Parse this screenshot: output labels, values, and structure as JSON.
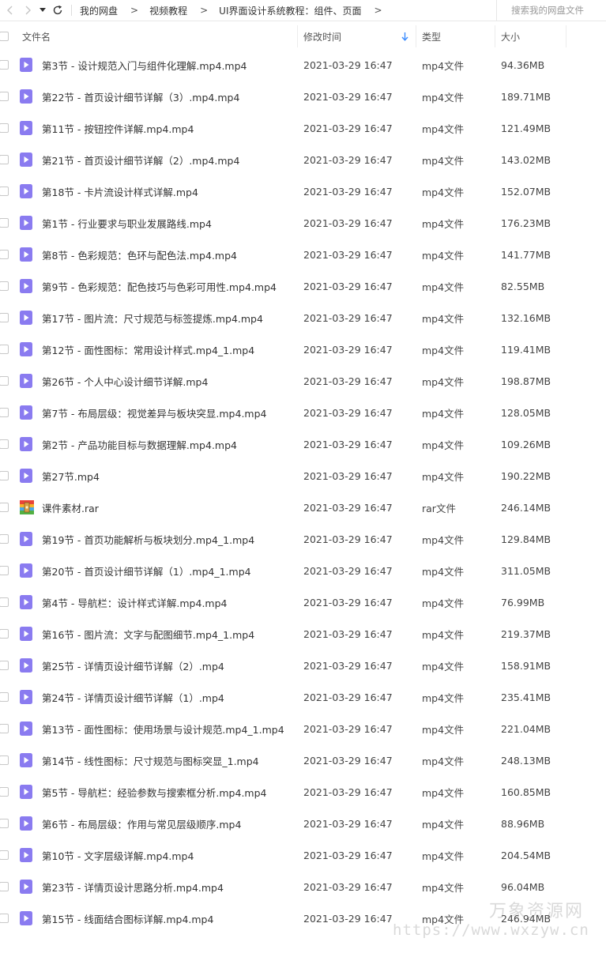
{
  "toolbar": {
    "breadcrumbs": [
      "我的网盘",
      "视频教程",
      "UI界面设计系统教程：组件、页面"
    ],
    "search_placeholder": "搜索我的网盘文件"
  },
  "columns": {
    "name": "文件名",
    "time": "修改时间",
    "type": "类型",
    "size": "大小",
    "sort_icon": "arrow-down-icon"
  },
  "colors": {
    "video_icon": "#8a7bf0",
    "sort_arrow": "#3b8cff"
  },
  "files": [
    {
      "name": "第3节 - 设计规范入门与组件化理解.mp4.mp4",
      "time": "2021-03-29 16:47",
      "type": "mp4文件",
      "size": "94.36MB",
      "icon": "video-file-icon"
    },
    {
      "name": "第22节 - 首页设计细节详解（3）.mp4.mp4",
      "time": "2021-03-29 16:47",
      "type": "mp4文件",
      "size": "189.71MB",
      "icon": "video-file-icon"
    },
    {
      "name": "第11节 - 按钮控件详解.mp4.mp4",
      "time": "2021-03-29 16:47",
      "type": "mp4文件",
      "size": "121.49MB",
      "icon": "video-file-icon"
    },
    {
      "name": "第21节 - 首页设计细节详解（2）.mp4.mp4",
      "time": "2021-03-29 16:47",
      "type": "mp4文件",
      "size": "143.02MB",
      "icon": "video-file-icon"
    },
    {
      "name": "第18节 - 卡片流设计样式详解.mp4",
      "time": "2021-03-29 16:47",
      "type": "mp4文件",
      "size": "152.07MB",
      "icon": "video-file-icon"
    },
    {
      "name": "第1节 - 行业要求与职业发展路线.mp4",
      "time": "2021-03-29 16:47",
      "type": "mp4文件",
      "size": "176.23MB",
      "icon": "video-file-icon"
    },
    {
      "name": "第8节 - 色彩规范：色环与配色法.mp4.mp4",
      "time": "2021-03-29 16:47",
      "type": "mp4文件",
      "size": "141.77MB",
      "icon": "video-file-icon"
    },
    {
      "name": "第9节 - 色彩规范：配色技巧与色彩可用性.mp4.mp4",
      "time": "2021-03-29 16:47",
      "type": "mp4文件",
      "size": "82.55MB",
      "icon": "video-file-icon"
    },
    {
      "name": "第17节 - 图片流：尺寸规范与标签提炼.mp4.mp4",
      "time": "2021-03-29 16:47",
      "type": "mp4文件",
      "size": "132.16MB",
      "icon": "video-file-icon"
    },
    {
      "name": "第12节 - 面性图标：常用设计样式.mp4_1.mp4",
      "time": "2021-03-29 16:47",
      "type": "mp4文件",
      "size": "119.41MB",
      "icon": "video-file-icon"
    },
    {
      "name": "第26节 - 个人中心设计细节详解.mp4",
      "time": "2021-03-29 16:47",
      "type": "mp4文件",
      "size": "198.87MB",
      "icon": "video-file-icon"
    },
    {
      "name": "第7节 - 布局层级：视觉差异与板块突显.mp4.mp4",
      "time": "2021-03-29 16:47",
      "type": "mp4文件",
      "size": "128.05MB",
      "icon": "video-file-icon"
    },
    {
      "name": "第2节 - 产品功能目标与数据理解.mp4.mp4",
      "time": "2021-03-29 16:47",
      "type": "mp4文件",
      "size": "109.26MB",
      "icon": "video-file-icon"
    },
    {
      "name": "第27节.mp4",
      "time": "2021-03-29 16:47",
      "type": "mp4文件",
      "size": "190.22MB",
      "icon": "video-file-icon"
    },
    {
      "name": "课件素材.rar",
      "time": "2021-03-29 16:47",
      "type": "rar文件",
      "size": "246.14MB",
      "icon": "archive-file-icon"
    },
    {
      "name": "第19节 - 首页功能解析与板块划分.mp4_1.mp4",
      "time": "2021-03-29 16:47",
      "type": "mp4文件",
      "size": "129.84MB",
      "icon": "video-file-icon"
    },
    {
      "name": "第20节 - 首页设计细节详解（1）.mp4_1.mp4",
      "time": "2021-03-29 16:47",
      "type": "mp4文件",
      "size": "311.05MB",
      "icon": "video-file-icon"
    },
    {
      "name": "第4节 - 导航栏：设计样式详解.mp4.mp4",
      "time": "2021-03-29 16:47",
      "type": "mp4文件",
      "size": "76.99MB",
      "icon": "video-file-icon"
    },
    {
      "name": "第16节 - 图片流：文字与配图细节.mp4_1.mp4",
      "time": "2021-03-29 16:47",
      "type": "mp4文件",
      "size": "219.37MB",
      "icon": "video-file-icon"
    },
    {
      "name": "第25节 - 详情页设计细节详解（2）.mp4",
      "time": "2021-03-29 16:47",
      "type": "mp4文件",
      "size": "158.91MB",
      "icon": "video-file-icon"
    },
    {
      "name": "第24节 - 详情页设计细节详解（1）.mp4",
      "time": "2021-03-29 16:47",
      "type": "mp4文件",
      "size": "235.41MB",
      "icon": "video-file-icon"
    },
    {
      "name": "第13节 - 面性图标：使用场景与设计规范.mp4_1.mp4",
      "time": "2021-03-29 16:47",
      "type": "mp4文件",
      "size": "221.04MB",
      "icon": "video-file-icon"
    },
    {
      "name": "第14节 - 线性图标：尺寸规范与图标突显_1.mp4",
      "time": "2021-03-29 16:47",
      "type": "mp4文件",
      "size": "248.13MB",
      "icon": "video-file-icon"
    },
    {
      "name": "第5节 - 导航栏：经验参数与搜索框分析.mp4.mp4",
      "time": "2021-03-29 16:47",
      "type": "mp4文件",
      "size": "160.85MB",
      "icon": "video-file-icon"
    },
    {
      "name": "第6节 - 布局层级：作用与常见层级顺序.mp4",
      "time": "2021-03-29 16:47",
      "type": "mp4文件",
      "size": "88.96MB",
      "icon": "video-file-icon"
    },
    {
      "name": "第10节 - 文字层级详解.mp4.mp4",
      "time": "2021-03-29 16:47",
      "type": "mp4文件",
      "size": "204.54MB",
      "icon": "video-file-icon"
    },
    {
      "name": "第23节 - 详情页设计思路分析.mp4.mp4",
      "time": "2021-03-29 16:47",
      "type": "mp4文件",
      "size": "96.04MB",
      "icon": "video-file-icon"
    },
    {
      "name": "第15节 - 线面结合图标详解.mp4.mp4",
      "time": "2021-03-29 16:47",
      "type": "mp4文件",
      "size": "246.94MB",
      "icon": "video-file-icon"
    }
  ],
  "watermark": {
    "line1": "万象资源网",
    "line2": "https://www.wxzyw.cn"
  }
}
